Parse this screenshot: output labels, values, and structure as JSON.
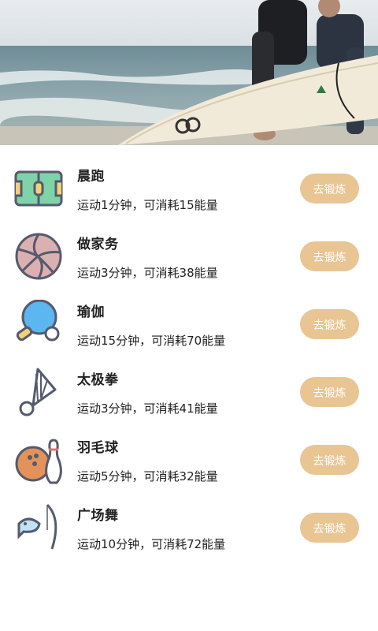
{
  "activities": [
    {
      "title": "晨跑",
      "desc": "运动1分钟，可消耗15能量",
      "button": "去锻炼",
      "icon": "soccer-field-icon"
    },
    {
      "title": "做家务",
      "desc": "运动3分钟，可消耗38能量",
      "button": "去锻炼",
      "icon": "volleyball-icon"
    },
    {
      "title": "瑜伽",
      "desc": "运动15分钟，可消耗70能量",
      "button": "去锻炼",
      "icon": "ping-pong-icon"
    },
    {
      "title": "太极拳",
      "desc": "运动3分钟，可消耗41能量",
      "button": "去锻炼",
      "icon": "shuttlecock-icon"
    },
    {
      "title": "羽毛球",
      "desc": "运动5分钟，可消耗32能量",
      "button": "去锻炼",
      "icon": "bowling-icon"
    },
    {
      "title": "广场舞",
      "desc": "运动10分钟，可消耗72能量",
      "button": "去锻炼",
      "icon": "fishing-icon"
    }
  ],
  "colors": {
    "button_bg": "#e9c594",
    "button_text": "#ffffff",
    "text": "#222222"
  }
}
